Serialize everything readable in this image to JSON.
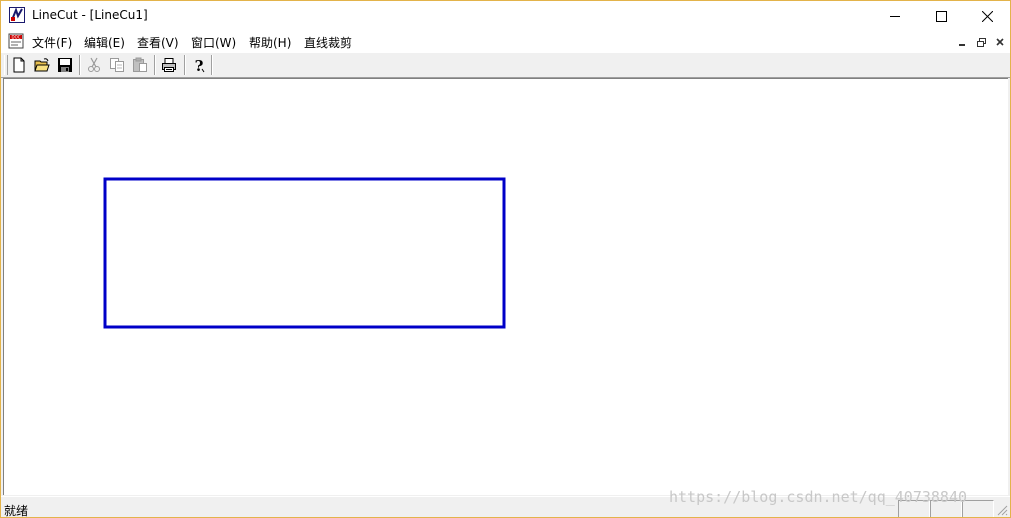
{
  "window": {
    "title": "LineCut - [LineCu1]",
    "border_color": "#e3b34a",
    "controls": {
      "minimize": "—",
      "maximize": "☐",
      "close": "✕"
    }
  },
  "menubar": {
    "items": [
      "文件(F)",
      "编辑(E)",
      "查看(V)",
      "窗口(W)",
      "帮助(H)",
      "直线裁剪"
    ],
    "mdi_controls": {
      "minimize": "_",
      "restore": "❐",
      "close": "×"
    }
  },
  "toolbar": {
    "buttons": [
      "new-icon",
      "open-icon",
      "save-icon",
      "cut-icon",
      "copy-icon",
      "paste-icon",
      "print-icon",
      "help-icon"
    ],
    "disabled": [
      "cut-icon",
      "copy-icon",
      "paste-icon"
    ]
  },
  "canvas": {
    "rectangle_color": "#0000c8"
  },
  "statusbar": {
    "text": "就绪"
  },
  "watermark": {
    "text": "https://blog.csdn.net/qq_40738840"
  }
}
